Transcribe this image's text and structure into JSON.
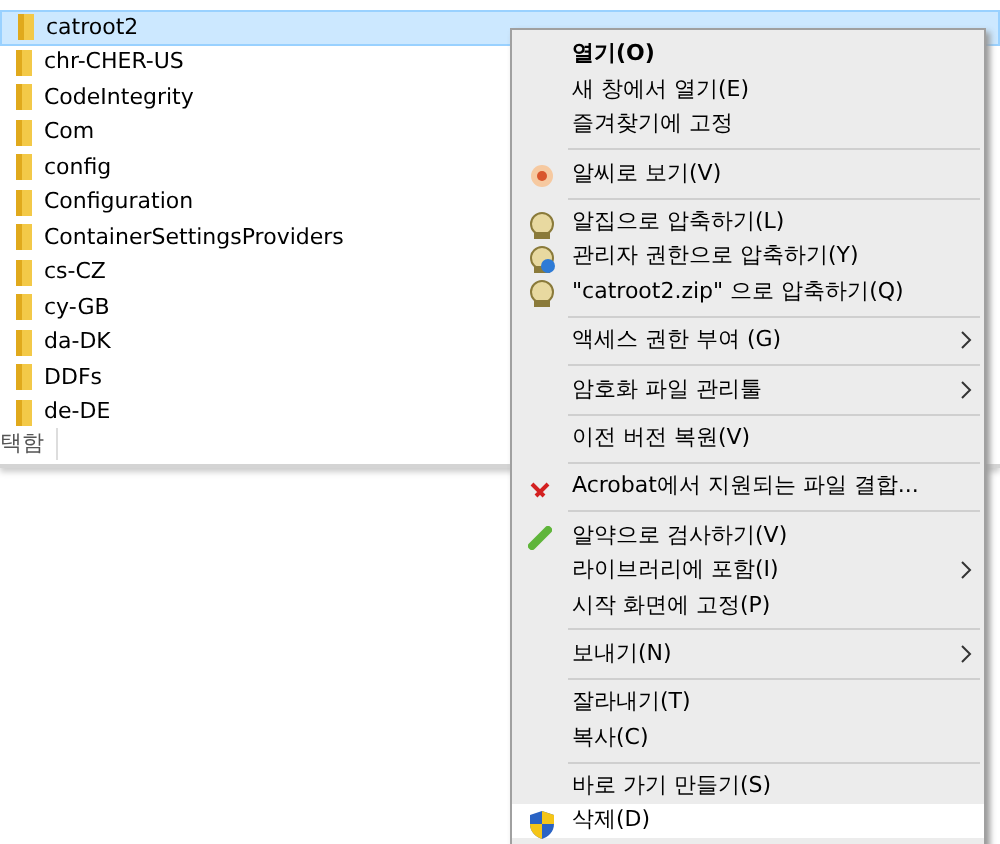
{
  "files": [
    {
      "name": "catroot2",
      "selected": true
    },
    {
      "name": "chr-CHER-US",
      "selected": false
    },
    {
      "name": "CodeIntegrity",
      "selected": false
    },
    {
      "name": "Com",
      "selected": false
    },
    {
      "name": "config",
      "selected": false
    },
    {
      "name": "Configuration",
      "selected": false
    },
    {
      "name": "ContainerSettingsProviders",
      "selected": false
    },
    {
      "name": "cs-CZ",
      "selected": false
    },
    {
      "name": "cy-GB",
      "selected": false
    },
    {
      "name": "da-DK",
      "selected": false
    },
    {
      "name": "DDFs",
      "selected": false
    },
    {
      "name": "de-DE",
      "selected": false
    }
  ],
  "status_bar": "택함",
  "context_menu": [
    {
      "kind": "default",
      "label": "열기(O)",
      "submenu": false,
      "selected": false
    },
    {
      "kind": "item",
      "label": "새 창에서 열기(E)",
      "submenu": false,
      "selected": false
    },
    {
      "kind": "item",
      "label": "즐겨찾기에 고정",
      "submenu": false,
      "selected": false
    },
    {
      "kind": "separator"
    },
    {
      "kind": "viewer",
      "label": "알씨로 보기(V)",
      "submenu": false,
      "selected": false
    },
    {
      "kind": "separator"
    },
    {
      "kind": "zip",
      "label": "알집으로 압축하기(L)",
      "submenu": false,
      "selected": false
    },
    {
      "kind": "zipadmin",
      "label": "관리자 권한으로 압축하기(Y)",
      "submenu": false,
      "selected": false
    },
    {
      "kind": "zip",
      "label": "\"catroot2.zip\" 으로 압축하기(Q)",
      "submenu": false,
      "selected": false
    },
    {
      "kind": "separator"
    },
    {
      "kind": "item",
      "label": "액세스 권한 부여 (G)",
      "submenu": true,
      "selected": false
    },
    {
      "kind": "separator"
    },
    {
      "kind": "item",
      "label": "암호화 파일 관리툴",
      "submenu": true,
      "selected": false
    },
    {
      "kind": "separator"
    },
    {
      "kind": "item",
      "label": "이전 버전 복원(V)",
      "submenu": false,
      "selected": false
    },
    {
      "kind": "separator"
    },
    {
      "kind": "pdf",
      "label": "Acrobat에서 지원되는 파일 결합...",
      "submenu": false,
      "selected": false
    },
    {
      "kind": "separator"
    },
    {
      "kind": "pill",
      "label": "알약으로 검사하기(V)",
      "submenu": false,
      "selected": false
    },
    {
      "kind": "item",
      "label": "라이브러리에 포함(I)",
      "submenu": true,
      "selected": false
    },
    {
      "kind": "item",
      "label": "시작 화면에 고정(P)",
      "submenu": false,
      "selected": false
    },
    {
      "kind": "separator"
    },
    {
      "kind": "item",
      "label": "보내기(N)",
      "submenu": true,
      "selected": false
    },
    {
      "kind": "separator"
    },
    {
      "kind": "item",
      "label": "잘라내기(T)",
      "submenu": false,
      "selected": false
    },
    {
      "kind": "item",
      "label": "복사(C)",
      "submenu": false,
      "selected": false
    },
    {
      "kind": "separator"
    },
    {
      "kind": "item",
      "label": "바로 가기 만들기(S)",
      "submenu": false,
      "selected": false
    },
    {
      "kind": "shield",
      "label": "삭제(D)",
      "submenu": false,
      "selected": true
    }
  ]
}
